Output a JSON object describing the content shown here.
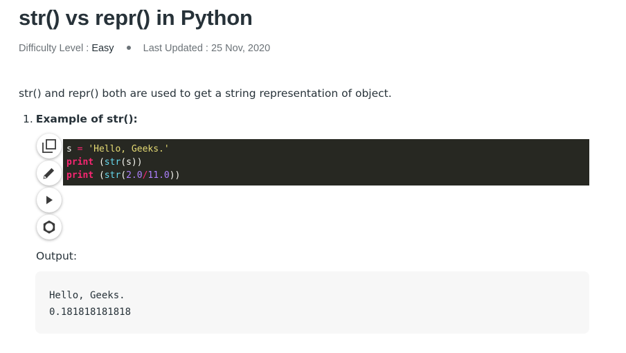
{
  "article": {
    "title": "str() vs repr() in Python",
    "difficulty_label": "Difficulty Level :",
    "difficulty_value": "Easy",
    "updated_label": "Last Updated :",
    "updated_value": "25 Nov, 2020",
    "intro": "str() and repr() both are used to get a string representation of object.",
    "list": [
      {
        "number": "1.",
        "heading": "Example of str():"
      }
    ],
    "output_label": "Output:"
  },
  "code": {
    "lines": [
      [
        {
          "text": "s",
          "type": "plain"
        },
        {
          "text": " ",
          "type": "plain"
        },
        {
          "text": "=",
          "type": "op"
        },
        {
          "text": " ",
          "type": "plain"
        },
        {
          "text": "'Hello, Geeks.'",
          "type": "str"
        }
      ],
      [
        {
          "text": "print",
          "type": "kw"
        },
        {
          "text": " (",
          "type": "plain"
        },
        {
          "text": "str",
          "type": "builtin"
        },
        {
          "text": "(s))",
          "type": "plain"
        }
      ],
      [
        {
          "text": "print",
          "type": "kw"
        },
        {
          "text": " (",
          "type": "plain"
        },
        {
          "text": "str",
          "type": "builtin"
        },
        {
          "text": "(",
          "type": "plain"
        },
        {
          "text": "2.0",
          "type": "num"
        },
        {
          "text": "/",
          "type": "op"
        },
        {
          "text": "11.0",
          "type": "num"
        },
        {
          "text": "))",
          "type": "plain"
        }
      ]
    ],
    "colors": {
      "background": "#272822",
      "keyword": "#f92672",
      "string": "#e6db74",
      "builtin": "#66d9ef",
      "number": "#ae81ff",
      "plain": "#f8f8f2"
    }
  },
  "toolbar": {
    "buttons": [
      {
        "name": "copy-button",
        "icon": "copy-icon"
      },
      {
        "name": "edit-button",
        "icon": "pencil-icon"
      },
      {
        "name": "run-button",
        "icon": "play-icon"
      },
      {
        "name": "settings-button",
        "icon": "gear-icon"
      }
    ]
  },
  "output": {
    "lines": [
      "Hello, Geeks.",
      "0.181818181818"
    ]
  }
}
